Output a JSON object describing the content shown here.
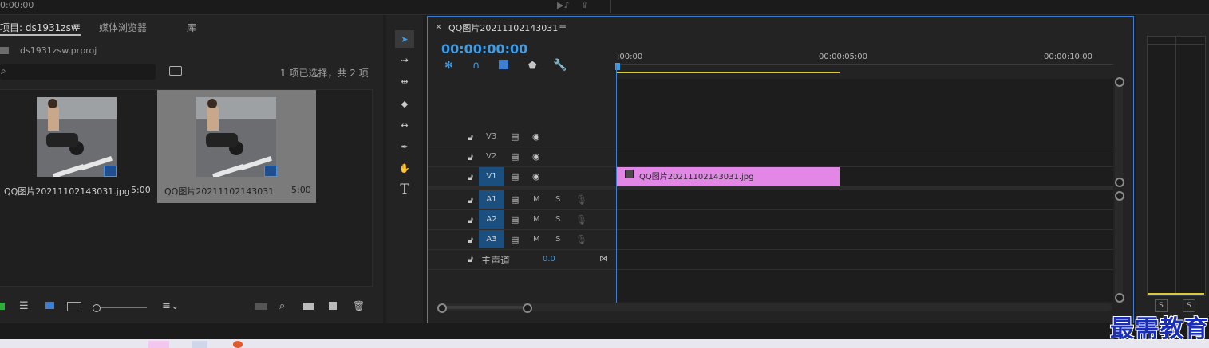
{
  "top": {
    "timecode_left": "0:00:00"
  },
  "project": {
    "tabs": [
      {
        "label": "项目: ds1931zsw",
        "active": true
      },
      {
        "label": "媒体浏览器",
        "active": false
      },
      {
        "label": "库",
        "active": false
      }
    ],
    "menu_glyph": "≡",
    "file_name": "ds1931zsw.prproj",
    "selection_status": "1 项已选择，共 2 项",
    "items": [
      {
        "name": "QQ图片20211102143031.jpg",
        "duration": "5:00",
        "selected": false
      },
      {
        "name": "QQ图片20211102143031",
        "duration": "5:00",
        "selected": true
      }
    ]
  },
  "tools": [
    {
      "name": "selection-tool-icon",
      "glyph": "➤"
    },
    {
      "name": "track-select-tool-icon",
      "glyph": "⇢"
    },
    {
      "name": "ripple-edit-tool-icon",
      "glyph": "⇹"
    },
    {
      "name": "razor-tool-icon",
      "glyph": "◆"
    },
    {
      "name": "slip-tool-icon",
      "glyph": "↔"
    },
    {
      "name": "pen-tool-icon",
      "glyph": "✒"
    },
    {
      "name": "hand-tool-icon",
      "glyph": "✋"
    },
    {
      "name": "type-tool-icon",
      "glyph": "T"
    }
  ],
  "timeline": {
    "sequence_tab": "QQ图片20211102143031",
    "close_glyph": "×",
    "menu_glyph": "≡",
    "timecode": "00:00:00:00",
    "ruler": [
      ":00:00",
      "00:00:05:00",
      "00:00:10:00"
    ],
    "video_tracks": [
      {
        "id": "V3",
        "targeted": false
      },
      {
        "id": "V2",
        "targeted": false
      },
      {
        "id": "V1",
        "targeted": true
      }
    ],
    "audio_tracks": [
      {
        "id": "A1",
        "m": "M",
        "s": "S"
      },
      {
        "id": "A2",
        "m": "M",
        "s": "S"
      },
      {
        "id": "A3",
        "m": "M",
        "s": "S"
      }
    ],
    "master": {
      "label": "主声道",
      "value": "0.0"
    },
    "clip": {
      "label": "QQ图片20211102143031.jpg",
      "color": "#e287e5"
    }
  },
  "meters": {
    "solo_left": "S",
    "solo_right": "S"
  },
  "watermark": "最需教育",
  "colors": {
    "accent": "#3d7fd4",
    "track_target": "#1b4f80",
    "work_area": "#d8c93b"
  }
}
